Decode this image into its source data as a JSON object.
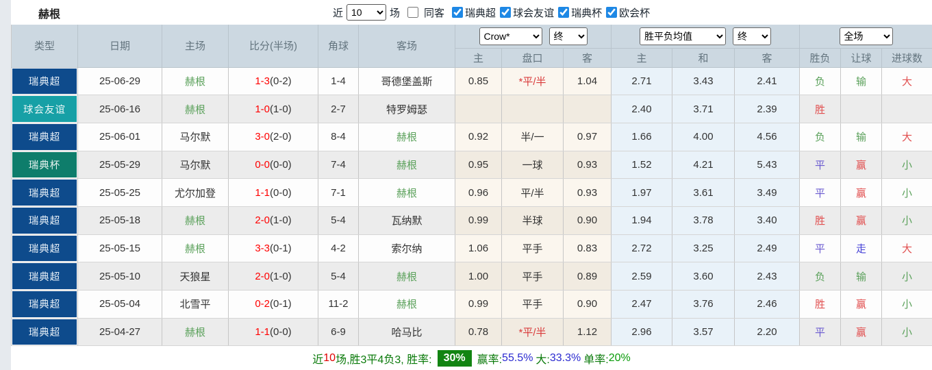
{
  "team": {
    "name": "赫根"
  },
  "toolbar": {
    "recent_label": "近",
    "count_value": "10",
    "matches_label": "场",
    "same_venue": {
      "label": "同客",
      "checked": false
    },
    "filters": [
      {
        "label": "瑞典超",
        "checked": true
      },
      {
        "label": "球会友谊",
        "checked": true
      },
      {
        "label": "瑞典杯",
        "checked": true
      },
      {
        "label": "欧会杯",
        "checked": true
      }
    ]
  },
  "table": {
    "selects": {
      "provider": "Crow*",
      "stage1": "终",
      "avg": "胜平负均值",
      "stage2": "终",
      "scope": "全场"
    },
    "headers": {
      "type": "类型",
      "date": "日期",
      "home": "主场",
      "score": "比分(半场)",
      "corners": "角球",
      "away": "客场",
      "crow_home": "主",
      "handicap": "盘口",
      "crow_away": "客",
      "avg_home": "主",
      "avg_draw": "和",
      "avg_away": "客",
      "result": "胜负",
      "cover": "让球",
      "goals": "进球数"
    },
    "rows": [
      {
        "type": "瑞典超",
        "type_color": "blue",
        "date": "25-06-29",
        "home": "赫根",
        "home_color": "team",
        "score": "1-3",
        "half": "(0-2)",
        "corners": "1-4",
        "away": "哥德堡盖斯",
        "away_color": "",
        "crow_home": "0.85",
        "handicap": "*平/半",
        "handicap_color": "red",
        "crow_away": "1.04",
        "avg_home": "2.71",
        "avg_draw": "3.43",
        "avg_away": "2.41",
        "result": "负",
        "result_color": "green",
        "cover": "输",
        "cover_color": "green",
        "goals": "大",
        "goals_color": "red"
      },
      {
        "type": "球会友谊",
        "type_color": "teal",
        "date": "25-06-16",
        "home": "赫根",
        "home_color": "team",
        "score": "1-0",
        "half": "(1-0)",
        "corners": "2-7",
        "away": "特罗姆瑟",
        "away_color": "",
        "crow_home": "",
        "handicap": "",
        "handicap_color": "",
        "crow_away": "",
        "avg_home": "2.40",
        "avg_draw": "3.71",
        "avg_away": "2.39",
        "result": "胜",
        "result_color": "red",
        "cover": "",
        "cover_color": "",
        "goals": "",
        "goals_color": ""
      },
      {
        "type": "瑞典超",
        "type_color": "blue",
        "date": "25-06-01",
        "home": "马尔默",
        "home_color": "",
        "score": "3-0",
        "half": "(2-0)",
        "corners": "8-4",
        "away": "赫根",
        "away_color": "team",
        "crow_home": "0.92",
        "handicap": "半/一",
        "handicap_color": "",
        "crow_away": "0.97",
        "avg_home": "1.66",
        "avg_draw": "4.00",
        "avg_away": "4.56",
        "result": "负",
        "result_color": "green",
        "cover": "输",
        "cover_color": "green",
        "goals": "大",
        "goals_color": "red"
      },
      {
        "type": "瑞典杯",
        "type_color": "dgreen",
        "date": "25-05-29",
        "home": "马尔默",
        "home_color": "",
        "score": "0-0",
        "half": "(0-0)",
        "corners": "7-4",
        "away": "赫根",
        "away_color": "team",
        "crow_home": "0.95",
        "handicap": "一球",
        "handicap_color": "",
        "crow_away": "0.93",
        "avg_home": "1.52",
        "avg_draw": "4.21",
        "avg_away": "5.43",
        "result": "平",
        "result_color": "purple",
        "cover": "赢",
        "cover_color": "red",
        "goals": "小",
        "goals_color": "green"
      },
      {
        "type": "瑞典超",
        "type_color": "blue",
        "date": "25-05-25",
        "home": "尤尔加登",
        "home_color": "",
        "score": "1-1",
        "half": "(0-0)",
        "corners": "7-1",
        "away": "赫根",
        "away_color": "team",
        "crow_home": "0.96",
        "handicap": "平/半",
        "handicap_color": "",
        "crow_away": "0.93",
        "avg_home": "1.97",
        "avg_draw": "3.61",
        "avg_away": "3.49",
        "result": "平",
        "result_color": "purple",
        "cover": "赢",
        "cover_color": "red",
        "goals": "小",
        "goals_color": "green"
      },
      {
        "type": "瑞典超",
        "type_color": "blue",
        "date": "25-05-18",
        "home": "赫根",
        "home_color": "team",
        "score": "2-0",
        "half": "(1-0)",
        "corners": "5-4",
        "away": "瓦纳默",
        "away_color": "",
        "crow_home": "0.99",
        "handicap": "半球",
        "handicap_color": "",
        "crow_away": "0.90",
        "avg_home": "1.94",
        "avg_draw": "3.78",
        "avg_away": "3.40",
        "result": "胜",
        "result_color": "red",
        "cover": "赢",
        "cover_color": "red",
        "goals": "小",
        "goals_color": "green"
      },
      {
        "type": "瑞典超",
        "type_color": "blue",
        "date": "25-05-15",
        "home": "赫根",
        "home_color": "team",
        "score": "3-3",
        "half": "(0-1)",
        "corners": "4-2",
        "away": "索尔纳",
        "away_color": "",
        "crow_home": "1.06",
        "handicap": "平手",
        "handicap_color": "",
        "crow_away": "0.83",
        "avg_home": "2.72",
        "avg_draw": "3.25",
        "avg_away": "2.49",
        "result": "平",
        "result_color": "purple",
        "cover": "走",
        "cover_color": "blue2",
        "goals": "大",
        "goals_color": "red"
      },
      {
        "type": "瑞典超",
        "type_color": "blue",
        "date": "25-05-10",
        "home": "天狼星",
        "home_color": "",
        "score": "2-0",
        "half": "(1-0)",
        "corners": "5-4",
        "away": "赫根",
        "away_color": "team",
        "crow_home": "1.00",
        "handicap": "平手",
        "handicap_color": "",
        "crow_away": "0.89",
        "avg_home": "2.59",
        "avg_draw": "3.60",
        "avg_away": "2.43",
        "result": "负",
        "result_color": "green",
        "cover": "输",
        "cover_color": "green",
        "goals": "小",
        "goals_color": "green"
      },
      {
        "type": "瑞典超",
        "type_color": "blue",
        "date": "25-05-04",
        "home": "北雪平",
        "home_color": "",
        "score": "0-2",
        "half": "(0-1)",
        "corners": "11-2",
        "away": "赫根",
        "away_color": "team",
        "crow_home": "0.99",
        "handicap": "平手",
        "handicap_color": "",
        "crow_away": "0.90",
        "avg_home": "2.47",
        "avg_draw": "3.76",
        "avg_away": "2.46",
        "result": "胜",
        "result_color": "red",
        "cover": "赢",
        "cover_color": "red",
        "goals": "小",
        "goals_color": "green"
      },
      {
        "type": "瑞典超",
        "type_color": "blue",
        "date": "25-04-27",
        "home": "赫根",
        "home_color": "team",
        "score": "1-1",
        "half": "(0-0)",
        "corners": "6-9",
        "away": "哈马比",
        "away_color": "",
        "crow_home": "0.78",
        "handicap": "*平/半",
        "handicap_color": "red",
        "crow_away": "1.12",
        "avg_home": "2.96",
        "avg_draw": "3.57",
        "avg_away": "2.20",
        "result": "平",
        "result_color": "purple",
        "cover": "赢",
        "cover_color": "red",
        "goals": "小",
        "goals_color": "green"
      }
    ]
  },
  "footer": {
    "recent_prefix": "近",
    "recent_count": "10",
    "summary_text": "场,胜3平4负3, 胜率:",
    "win_rate": "30%",
    "cover_label": "赢率:",
    "cover_value": "55.5%",
    "big_label": "大:",
    "big_value": "33.3%",
    "single_label": "单率:",
    "single_value": "20%"
  }
}
